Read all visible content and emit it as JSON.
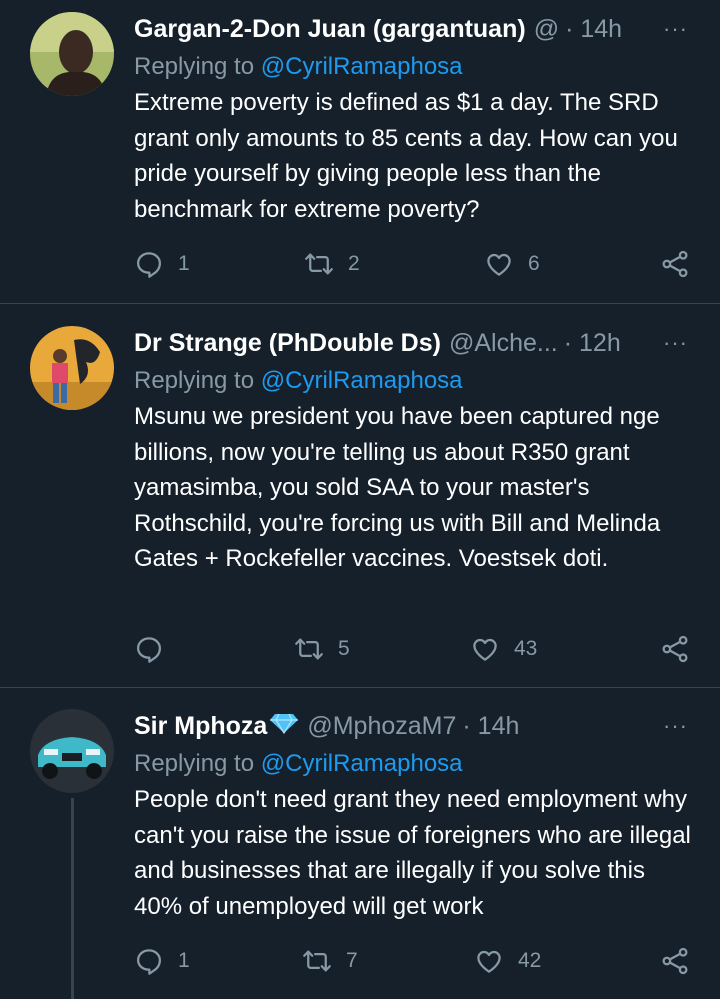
{
  "tweets": [
    {
      "name": "Gargan-2-Don Juan (gargantuan)",
      "handle": "@",
      "time": "· 14h",
      "more": "···",
      "replying_prefix": "Replying to ",
      "replying_to": "@CyrilRamaphosa",
      "text": "Extreme poverty is defined as $1 a day. The SRD grant only amounts to 85 cents a day. How can you pride yourself by giving people less than the benchmark for extreme poverty?",
      "replies": "1",
      "retweets": "2",
      "likes": "6"
    },
    {
      "name": "Dr Strange (PhDouble Ds)",
      "handle": "@Alche...",
      "time": "· 12h",
      "more": "···",
      "replying_prefix": "Replying to ",
      "replying_to": "@CyrilRamaphosa",
      "text": "Msunu we president you have been captured nge billions, now you're telling us about R350 grant yamasimba, you sold SAA to your master's Rothschild, you're forcing us with Bill and Melinda Gates + Rockefeller vaccines. Voestsek doti.",
      "replies": "",
      "retweets": "5",
      "likes": "43"
    },
    {
      "name": "Sir Mphoza",
      "handle": "@MphozaM7",
      "time": "· 14h",
      "more": "···",
      "replying_prefix": "Replying to ",
      "replying_to": "@CyrilRamaphosa",
      "text": "People don't need grant they need employment why can't you raise the issue of foreigners who are illegal and businesses that are illegally if you solve this 40% of unemployed will get work",
      "replies": "1",
      "retweets": "7",
      "likes": "42"
    }
  ],
  "icons": {
    "reply": "reply-icon",
    "retweet": "retweet-icon",
    "like": "heart-icon",
    "share": "share-icon",
    "verified_badge": "diamond-icon"
  },
  "colors": {
    "background": "#15202b",
    "secondary_text": "#8899a6",
    "link": "#1d9bf0",
    "divider": "#38444d"
  }
}
